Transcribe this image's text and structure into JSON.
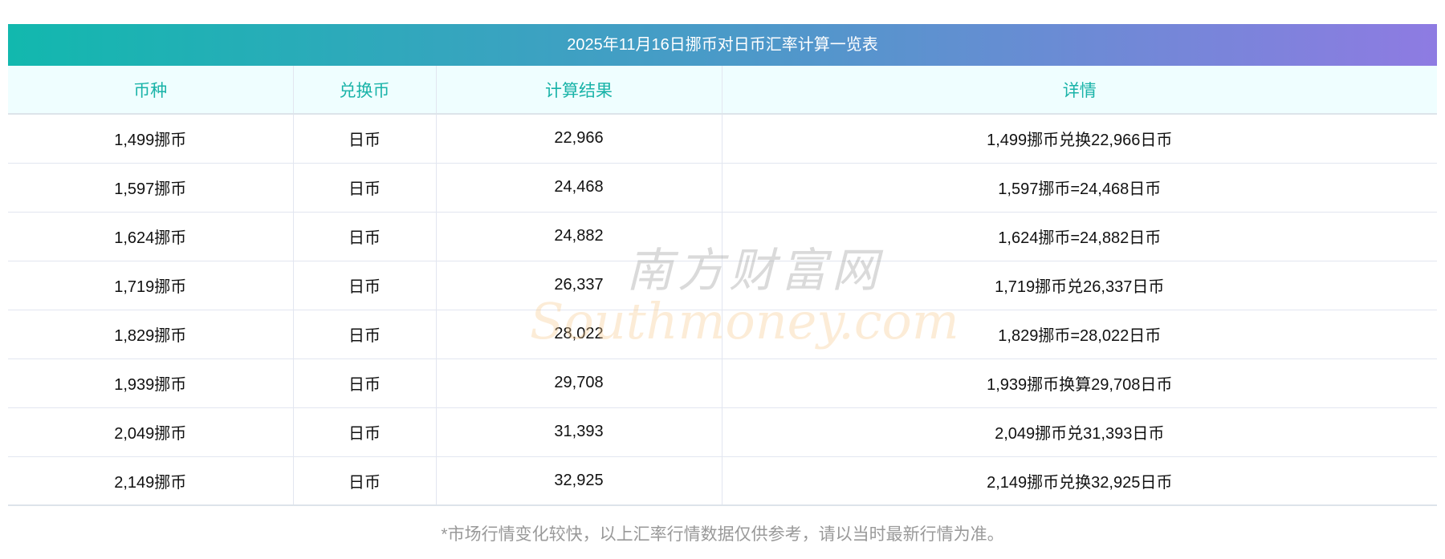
{
  "title": "2025年11月16日挪币对日币汇率计算一览表",
  "headers": [
    "币种",
    "兑换币",
    "计算结果",
    "详情"
  ],
  "rows": [
    [
      "1,499挪币",
      "日币",
      "22,966",
      "1,499挪币兑换22,966日币"
    ],
    [
      "1,597挪币",
      "日币",
      "24,468",
      "1,597挪币=24,468日币"
    ],
    [
      "1,624挪币",
      "日币",
      "24,882",
      "1,624挪币=24,882日币"
    ],
    [
      "1,719挪币",
      "日币",
      "26,337",
      "1,719挪币兑26,337日币"
    ],
    [
      "1,829挪币",
      "日币",
      "28,022",
      "1,829挪币=28,022日币"
    ],
    [
      "1,939挪币",
      "日币",
      "29,708",
      "1,939挪币换算29,708日币"
    ],
    [
      "2,049挪币",
      "日币",
      "31,393",
      "2,049挪币兑31,393日币"
    ],
    [
      "2,149挪币",
      "日币",
      "32,925",
      "2,149挪币兑换32,925日币"
    ]
  ],
  "note": "*市场行情变化较快，以上汇率行情数据仅供参考，请以当时最新行情为准。",
  "watermark": {
    "cn": "南方财富网",
    "en": "Southmoney.com"
  }
}
